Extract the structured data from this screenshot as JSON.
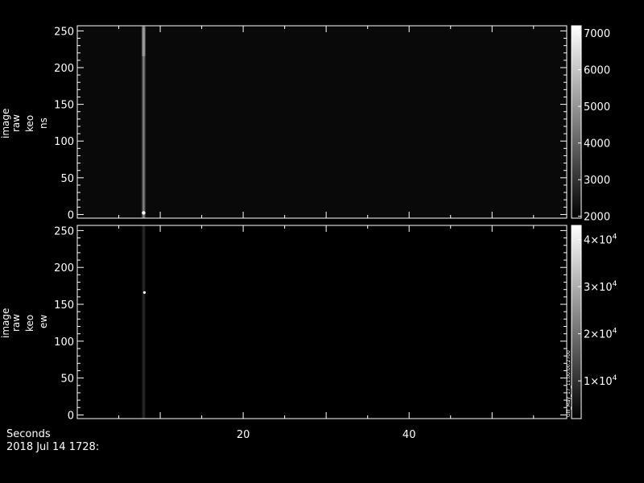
{
  "colors": {
    "background": "#000000",
    "axes": "#ffffff",
    "text": "#ffffff"
  },
  "footer": {
    "x_label": "Seconds",
    "date_label": "2018 Jul 14 1728:"
  },
  "chart_data": [
    {
      "type": "heatmap",
      "ylabel_lines": [
        "image",
        "raw",
        "keo",
        "ns"
      ],
      "xlim": [
        0,
        59
      ],
      "ylim": [
        -5,
        257
      ],
      "y_ticks": [
        0,
        50,
        100,
        150,
        200,
        250
      ],
      "x_ticks": [
        20,
        40
      ],
      "background_level": 2130,
      "bright_column_x": 8.0,
      "colorbar": {
        "range": [
          1950,
          7200
        ],
        "ticks": [
          {
            "value": 2000,
            "label": "2000"
          },
          {
            "value": 3000,
            "label": "3000"
          },
          {
            "value": 4000,
            "label": "4000"
          },
          {
            "value": 5000,
            "label": "5000"
          },
          {
            "value": 6000,
            "label": "6000"
          },
          {
            "value": 7000,
            "label": "7000"
          }
        ]
      }
    },
    {
      "type": "heatmap",
      "ylabel_lines": [
        "image",
        "raw",
        "keo",
        "ew"
      ],
      "xlim": [
        0,
        59
      ],
      "ylim": [
        -5,
        257
      ],
      "y_ticks": [
        0,
        50,
        100,
        150,
        200,
        250
      ],
      "x_ticks": [
        20,
        40
      ],
      "background_level": 900,
      "bright_column_x": 8.0,
      "bright_spot_y": 166,
      "colorbar": {
        "range": [
          2000,
          43000
        ],
        "ticks": [
          {
            "value": 10000,
            "label": "1×10",
            "exp": "4"
          },
          {
            "value": 20000,
            "label": "2×10",
            "exp": "4"
          },
          {
            "value": 30000,
            "label": "3×10",
            "exp": "4"
          },
          {
            "value": 40000,
            "label": "4×10",
            "exp": "4"
          }
        ],
        "side_note": "Gill_May_17_11:00:00.2700"
      }
    }
  ]
}
